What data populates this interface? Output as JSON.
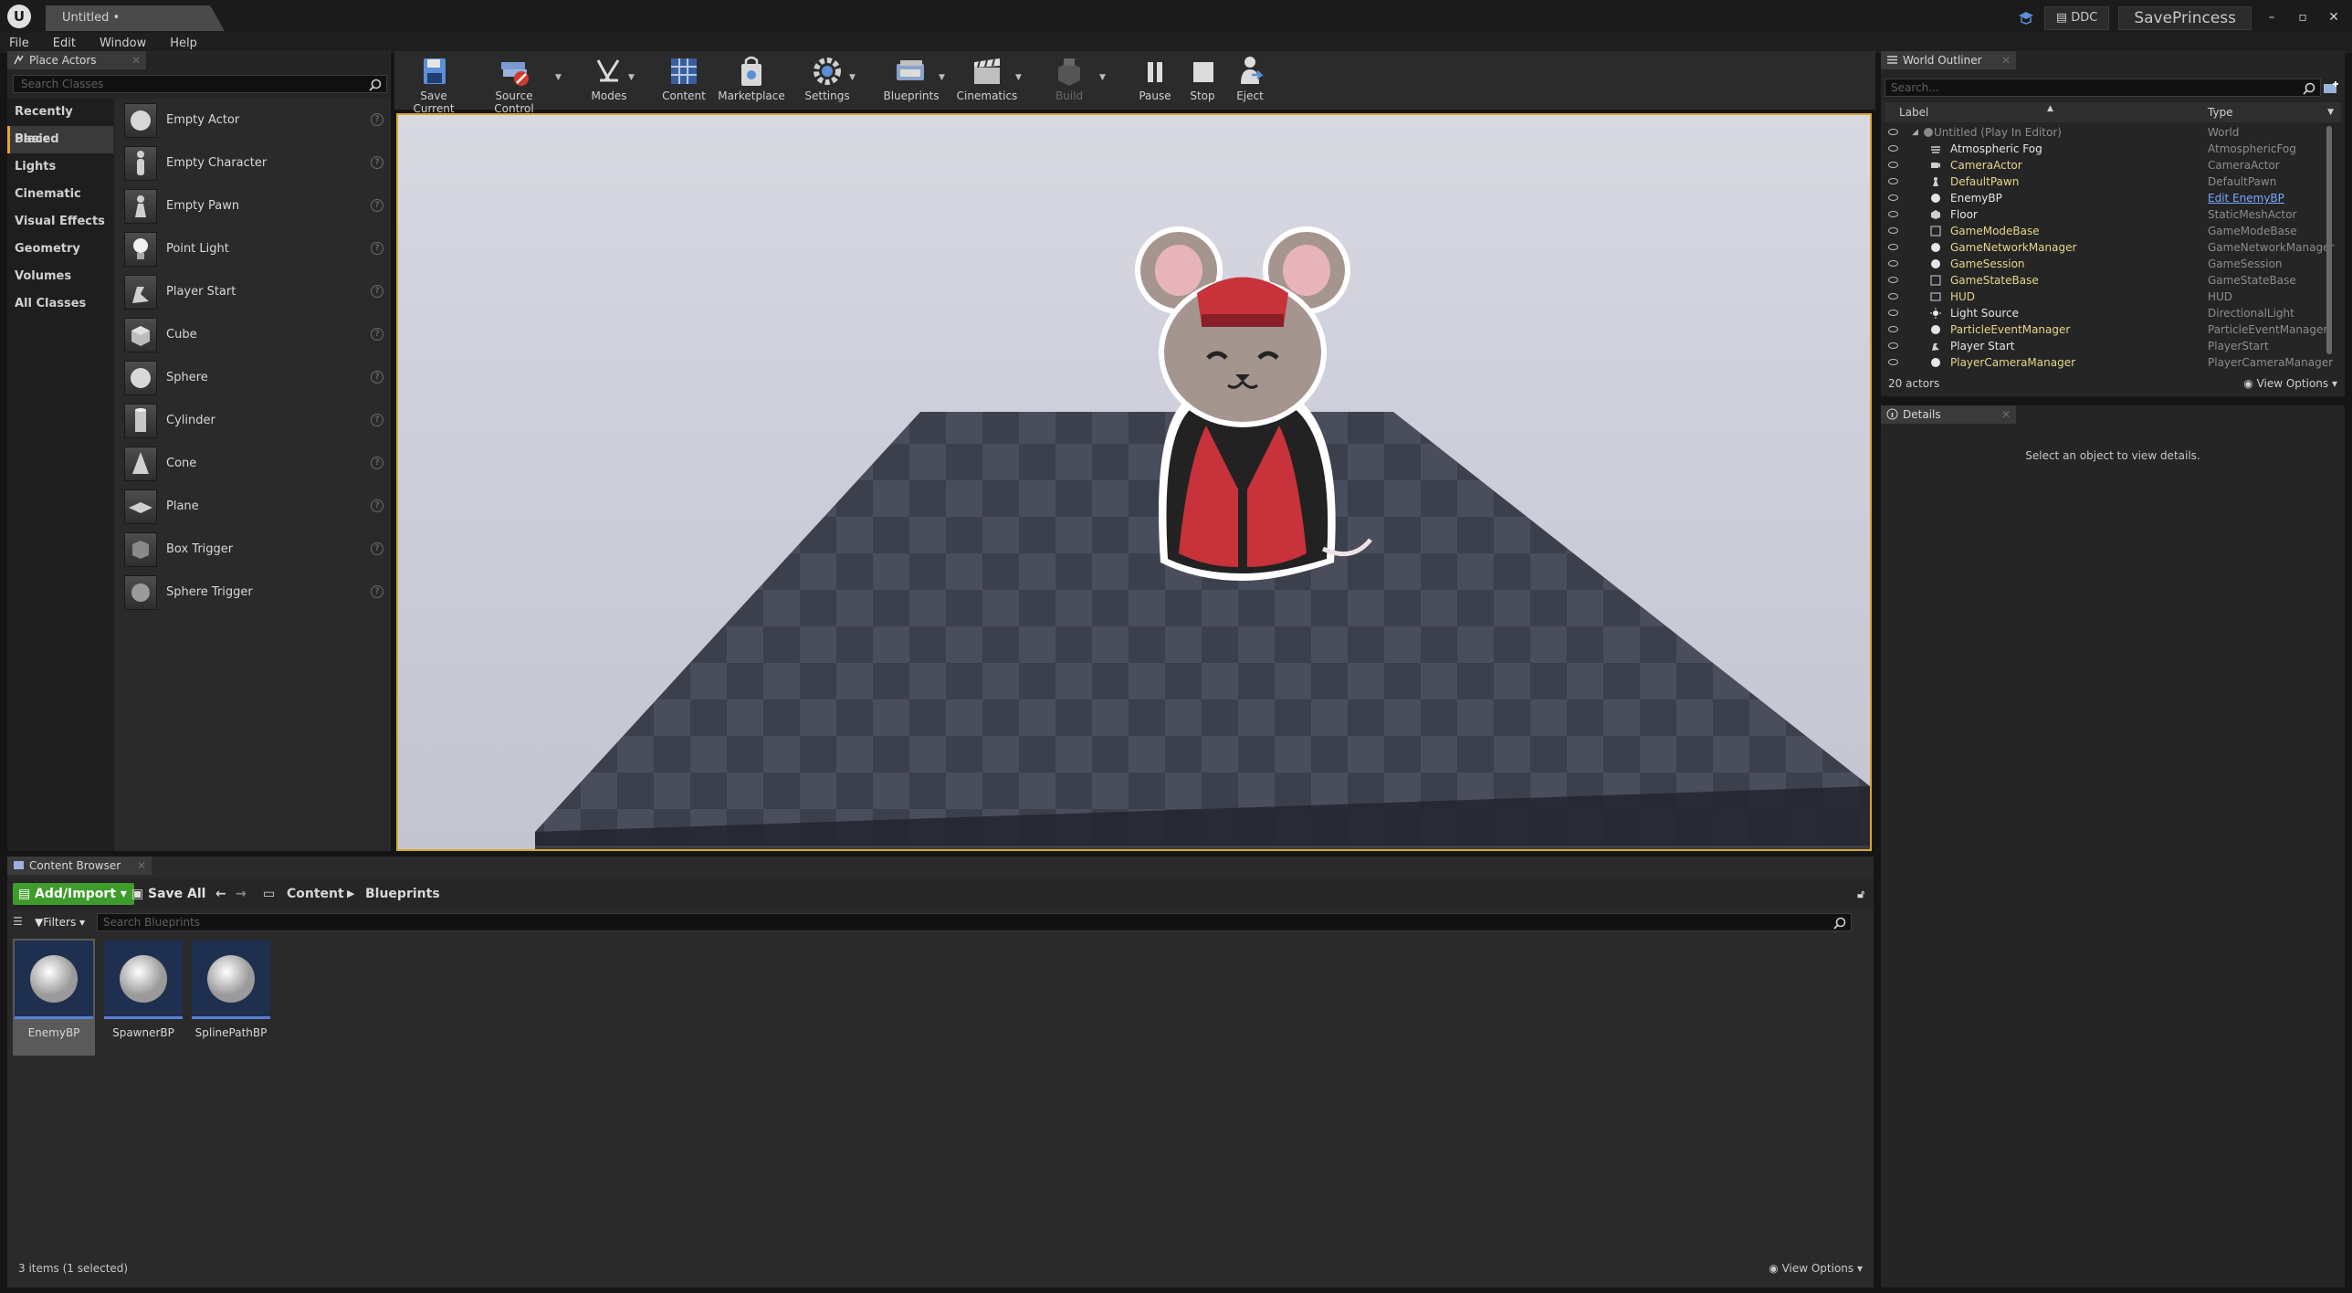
{
  "titlebar": {
    "document_tab": "Untitled •",
    "ddc_label": "DDC",
    "project_name": "SavePrincess",
    "window_buttons": [
      "–",
      "▫",
      "✕"
    ]
  },
  "menu": [
    "File",
    "Edit",
    "Window",
    "Help"
  ],
  "place_actors": {
    "tab_label": "Place Actors",
    "search_placeholder": "Search Classes",
    "categories": [
      "Recently Placed",
      "Basic",
      "Lights",
      "Cinematic",
      "Visual Effects",
      "Geometry",
      "Volumes",
      "All Classes"
    ],
    "active_category": "Basic",
    "items": [
      {
        "label": "Empty Actor",
        "icon": "sphere-thumb-icon"
      },
      {
        "label": "Empty Character",
        "icon": "character-thumb-icon"
      },
      {
        "label": "Empty Pawn",
        "icon": "pawn-thumb-icon"
      },
      {
        "label": "Point Light",
        "icon": "lightbulb-thumb-icon"
      },
      {
        "label": "Player Start",
        "icon": "player-start-thumb-icon"
      },
      {
        "label": "Cube",
        "icon": "cube-thumb-icon"
      },
      {
        "label": "Sphere",
        "icon": "sphere-thumb-icon"
      },
      {
        "label": "Cylinder",
        "icon": "cylinder-thumb-icon"
      },
      {
        "label": "Cone",
        "icon": "cone-thumb-icon"
      },
      {
        "label": "Plane",
        "icon": "plane-thumb-icon"
      },
      {
        "label": "Box Trigger",
        "icon": "box-trigger-thumb-icon"
      },
      {
        "label": "Sphere Trigger",
        "icon": "sphere-trigger-thumb-icon"
      }
    ]
  },
  "toolbar": {
    "save_current": "Save Current",
    "source_control": "Source Control",
    "modes": "Modes",
    "content": "Content",
    "marketplace": "Marketplace",
    "settings": "Settings",
    "blueprints": "Blueprints",
    "cinematics": "Cinematics",
    "build": "Build",
    "pause": "Pause",
    "stop": "Stop",
    "eject": "Eject"
  },
  "outliner": {
    "tab_label": "World Outliner",
    "search_placeholder": "Search...",
    "col_label": "Label",
    "col_type": "Type",
    "rows": [
      {
        "label": "Untitled (Play In Editor)",
        "type": "World"
      },
      {
        "label": "Atmospheric Fog",
        "type": "AtmosphericFog"
      },
      {
        "label": "CameraActor",
        "type": "CameraActor"
      },
      {
        "label": "DefaultPawn",
        "type": "DefaultPawn"
      },
      {
        "label": "EnemyBP",
        "type": "Edit EnemyBP"
      },
      {
        "label": "Floor",
        "type": "StaticMeshActor"
      },
      {
        "label": "GameModeBase",
        "type": "GameModeBase"
      },
      {
        "label": "GameNetworkManager",
        "type": "GameNetworkManager"
      },
      {
        "label": "GameSession",
        "type": "GameSession"
      },
      {
        "label": "GameStateBase",
        "type": "GameStateBase"
      },
      {
        "label": "HUD",
        "type": "HUD"
      },
      {
        "label": "Light Source",
        "type": "DirectionalLight"
      },
      {
        "label": "ParticleEventManager",
        "type": "ParticleEventManager"
      },
      {
        "label": "Player Start",
        "type": "PlayerStart"
      },
      {
        "label": "PlayerCameraManager",
        "type": "PlayerCameraManager"
      }
    ],
    "actor_count": "20 actors",
    "view_options": "View Options"
  },
  "details": {
    "tab_label": "Details",
    "empty_text": "Select an object to view details."
  },
  "content_browser": {
    "tab_label": "Content Browser",
    "add_import": "Add/Import",
    "save_all": "Save All",
    "breadcrumb": [
      "Content",
      "Blueprints"
    ],
    "filters": "Filters",
    "search_placeholder": "Search Blueprints",
    "assets": [
      {
        "name": "EnemyBP",
        "selected": true
      },
      {
        "name": "SpawnerBP",
        "selected": false
      },
      {
        "name": "SplinePathBP",
        "selected": false
      }
    ],
    "status": "3 items (1 selected)",
    "view_options": "View Options"
  },
  "colors": {
    "accent_orange": "#e8a23a",
    "add_import_green": "#3f9b2b",
    "viewport_border": "#d9a72c",
    "outliner_label": "#e6d58d",
    "link_blue": "#7aa7ff"
  }
}
